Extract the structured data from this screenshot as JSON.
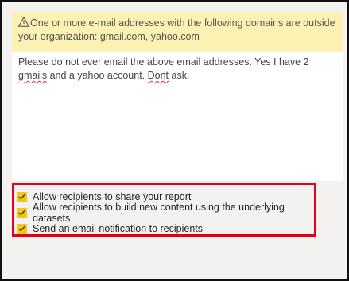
{
  "warning": {
    "icon": "warning-triangle-icon",
    "text": "One or more e-mail addresses with the following domains are outside your organization: gmail.com, yahoo.com"
  },
  "message": {
    "part1": "Please do not ever email the above email addresses. Yes I have 2 ",
    "misspelled1": "gmails",
    "part2": " and a yahoo account. ",
    "misspelled2": "Dont",
    "part3": " ask."
  },
  "options": [
    {
      "label": "Allow recipients to share your report",
      "checked": true
    },
    {
      "label": "Allow recipients to build new content using the underlying datasets",
      "checked": true
    },
    {
      "label": "Send an email notification to recipients",
      "checked": true
    }
  ],
  "colors": {
    "warning_bg": "#fbf1b3",
    "checkbox": "#f2c811",
    "highlight_border": "#e3001b",
    "spellcheck": "#d13438"
  }
}
